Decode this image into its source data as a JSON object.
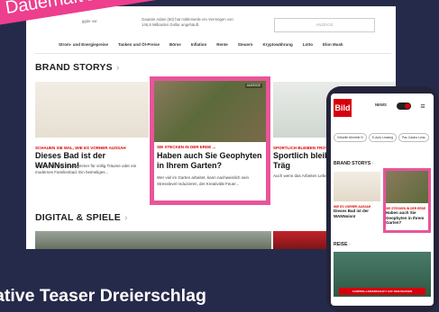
{
  "badge": "Dauerhaft zu",
  "desktop": {
    "snippet_left": "ggier vor.",
    "snippet_mid": "Gautam Adani (60) hat mittlerweile ein Vermögen von 146,8 Milliarden Dollar angehäuft.",
    "ad_label": "ANZEIGE",
    "nav": [
      "Strom- und Energiepreise",
      "Tanken und Öl-Preise",
      "Börse",
      "Inflation",
      "Rente",
      "Steuern",
      "Kryptowährung",
      "Lotto",
      "Elon Musk"
    ],
    "brand_title": "BRAND STORYS",
    "cards": [
      {
        "kicker": "SCHAUEN SIE MAL, WIE ES VORHER AUSSAH",
        "title": "Dieses Bad ist der WANNsinn!",
        "teaser": "Ein gemütliches Schlafzimmer für völlig Träume oder ein modernes Familienbad. Ein heimeliges...",
        "sticker": ""
      },
      {
        "kicker": "SIE STECKEN IN DER ERDE ...",
        "title": "Haben auch Sie Geophyten in Ihrem Garten?",
        "teaser": "Wer viel im Garten arbeitet, kann nachweislich sein Stresslevel reduzieren, der Kreativität Feuer...",
        "sticker": "ANZEIGE"
      },
      {
        "kicker": "SPORTLICH BLEIBEN TROT",
        "title": "Sportlich bleiben Homeoffice-Träg",
        "teaser": "Auch wenn das Arbeiten Leben teilweise leichter",
        "sticker": ""
      }
    ],
    "digital_title": "DIGITAL & SPIELE"
  },
  "caption": "ative Teaser Dreierschlag",
  "phone": {
    "logo": "Bild",
    "news_label": "NEWS",
    "menu_icon": "≡",
    "chips": [
      "Virtuelle Ahnöhle N",
      "E-Auto Leasing",
      "Pac Casino Leas"
    ],
    "brand_title": "BRAND STORYS",
    "cards": [
      {
        "kicker": "WIE ES VORHER AUSSAH",
        "title": "Dieses Bad ist der WANNsinn!"
      },
      {
        "kicker": "SIE STECKEN IN DER ERDE",
        "title": "Haben auch Sie Geophyten in Ihrem Garten?"
      }
    ],
    "reise_title": "REISE",
    "reise_label": "CAMPING-LEIDENSCHAFT AUF DEM WASSER"
  },
  "colors": {
    "background": "#262a4a",
    "highlight": "#e8559a",
    "bild_red": "#d6000c"
  }
}
